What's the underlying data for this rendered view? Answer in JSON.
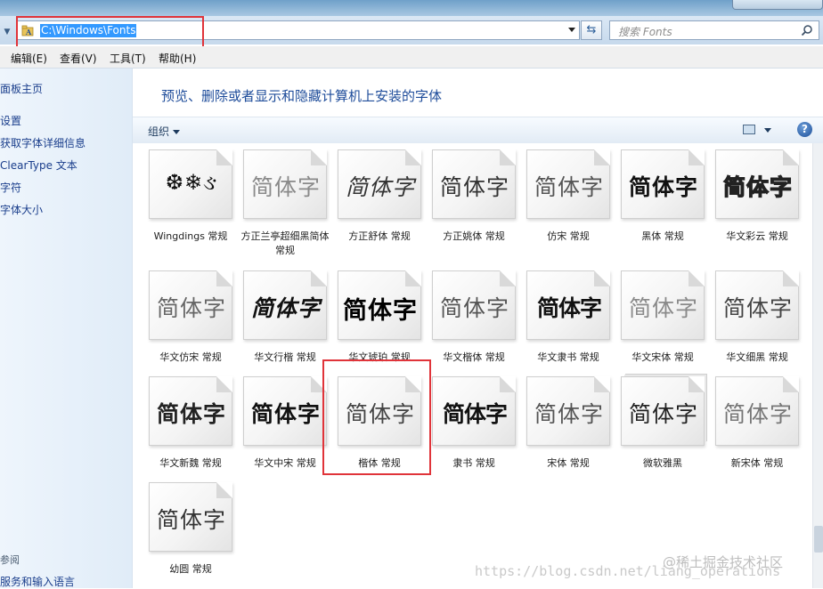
{
  "address": {
    "path": "C:\\Windows\\Fonts"
  },
  "search": {
    "placeholder": "搜索 Fonts"
  },
  "menu": [
    "编辑(E)",
    "查看(V)",
    "工具(T)",
    "帮助(H)"
  ],
  "sidebar": {
    "links": [
      "面板主页",
      "设置",
      "获取字体详细信息",
      "ClearType 文本",
      "字符",
      "字体大小"
    ],
    "see_also": "参阅",
    "see_also_links": [
      "服务和输入语言"
    ]
  },
  "header": {
    "title": "预览、删除或者显示和隐藏计算机上安装的字体"
  },
  "toolbar": {
    "organize": "组织"
  },
  "fonts": [
    {
      "sample": "❆❄ઙ",
      "label": "Wingdings 常规"
    },
    {
      "sample": "简体字",
      "label": "方正兰亭超细黑简体 常规"
    },
    {
      "sample": "简体字",
      "label": "方正舒体 常规"
    },
    {
      "sample": "简体字",
      "label": "方正姚体 常规"
    },
    {
      "sample": "简体字",
      "label": "仿宋 常规"
    },
    {
      "sample": "简体字",
      "label": "黑体 常规"
    },
    {
      "sample": "简体字",
      "label": "华文彩云 常规"
    },
    {
      "sample": "简体字",
      "label": "华文仿宋 常规"
    },
    {
      "sample": "简体字",
      "label": "华文行楷 常规"
    },
    {
      "sample": "简体字",
      "label": "华文琥珀 常规"
    },
    {
      "sample": "简体字",
      "label": "华文楷体 常规"
    },
    {
      "sample": "简体字",
      "label": "华文隶书 常规"
    },
    {
      "sample": "简体字",
      "label": "华文宋体 常规"
    },
    {
      "sample": "简体字",
      "label": "华文细黑 常规"
    },
    {
      "sample": "简体字",
      "label": "华文新魏 常规"
    },
    {
      "sample": "简体字",
      "label": "华文中宋 常规"
    },
    {
      "sample": "简体字",
      "label": "楷体 常规"
    },
    {
      "sample": "简体字",
      "label": "隶书 常规"
    },
    {
      "sample": "简体字",
      "label": "宋体 常规"
    },
    {
      "sample": "简体字",
      "label": "微软雅黑"
    },
    {
      "sample": "简体字",
      "label": "新宋体 常规"
    },
    {
      "sample": "简体字",
      "label": "幼圆 常规"
    }
  ],
  "watermark": {
    "line1": "@稀土掘金技术社区",
    "line2": "https://blog.csdn.net/liang_operations"
  },
  "colors": {
    "highlight_box": "#e0343a",
    "selection": "#3399ff",
    "link": "#1a3e8c",
    "header": "#1e4c9a"
  }
}
